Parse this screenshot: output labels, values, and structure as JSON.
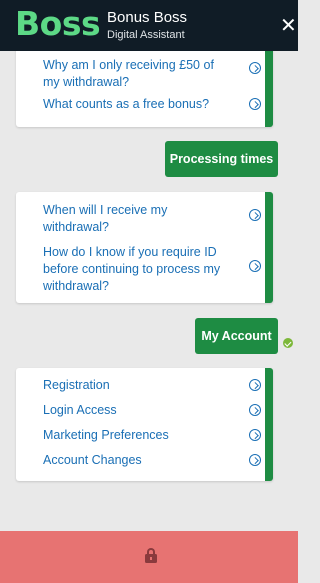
{
  "header": {
    "logo_text": "Boss",
    "title": "Bonus Boss",
    "subtitle": "Digital Assistant",
    "close_glyph": "✕"
  },
  "messages": {
    "card1": {
      "items": [
        {
          "label": "Why am I only receiving £50 of my withdrawal?"
        },
        {
          "label": "What counts as a free bonus?"
        }
      ]
    },
    "user_msg1": {
      "text": "Processing times"
    },
    "card2": {
      "items": [
        {
          "label": "When will I receive my withdrawal?"
        },
        {
          "label": "How do I know if you require ID before continuing to process my withdrawal?"
        }
      ]
    },
    "user_msg2": {
      "text": "My Account",
      "status": "delivered-check-icon"
    },
    "card3": {
      "items": [
        {
          "label": "Registration"
        },
        {
          "label": "Login Access"
        },
        {
          "label": "Marketing Preferences"
        },
        {
          "label": "Account Changes"
        }
      ]
    }
  },
  "footer": {
    "icon": "lock-icon"
  },
  "colors": {
    "header_bg": "#101c26",
    "brand_green": "#1e8c43",
    "logo_green": "#5dd986",
    "link_blue": "#1a6fb5",
    "footer_bg": "#e77372"
  }
}
